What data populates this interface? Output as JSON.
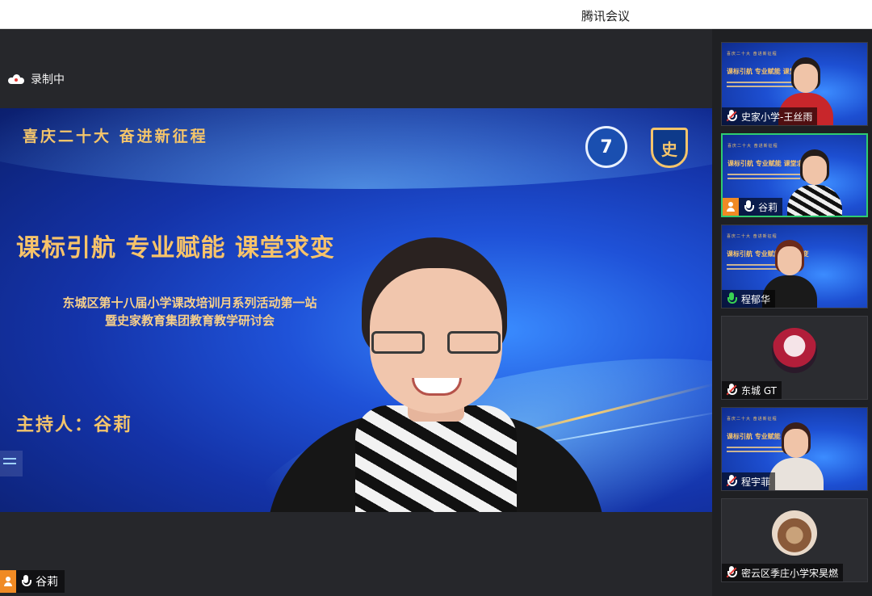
{
  "window": {
    "title": "腾讯会议"
  },
  "recording": {
    "label": "录制中"
  },
  "slide": {
    "slogan": "喜庆二十大 奋进新征程",
    "headline": "课标引航 专业赋能 课堂求变",
    "subtitle_line1": "东城区第十八届小学课改培训月系列活动第一站",
    "subtitle_line2": "暨史家教育集团教育教学研讨会",
    "host": "主持人：谷莉",
    "logo2_text": "史"
  },
  "active_speaker": {
    "name": "谷莉"
  },
  "participants": [
    {
      "name": "史家小学-王丝雨",
      "mic": "muted",
      "video": "slide"
    },
    {
      "name": "谷莉",
      "mic": "on",
      "video": "slide",
      "active": true,
      "host": true
    },
    {
      "name": "程郁华",
      "mic": "speaking",
      "video": "slide"
    },
    {
      "name": "东城 GT",
      "mic": "muted",
      "video": "avatar"
    },
    {
      "name": "程宇菲",
      "mic": "muted",
      "video": "slide"
    },
    {
      "name": "密云区季庄小学宋昊燃",
      "mic": "muted",
      "video": "avatar"
    }
  ],
  "colors": {
    "accent_gold": "#f7c36a",
    "slide_blue": "#1f52d8",
    "speaking_green": "#39d353",
    "host_orange": "#f08a24"
  }
}
